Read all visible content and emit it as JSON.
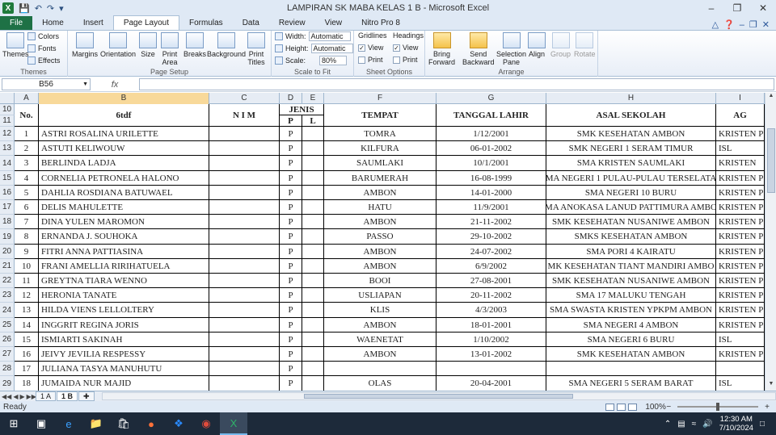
{
  "app": {
    "title": "LAMPIRAN SK MABA KELAS 1 B  -  Microsoft Excel"
  },
  "ribbon_tabs": [
    "File",
    "Home",
    "Insert",
    "Page Layout",
    "Formulas",
    "Data",
    "Review",
    "View",
    "Nitro Pro 8"
  ],
  "active_tab": "Page Layout",
  "ribbon": {
    "themes": {
      "themes": "Themes",
      "colors": "Colors",
      "fonts": "Fonts",
      "effects": "Effects",
      "label": "Themes"
    },
    "page_setup": {
      "margins": "Margins",
      "orientation": "Orientation",
      "size": "Size",
      "print_area_1": "Print",
      "print_area_2": "Area",
      "breaks": "Breaks",
      "background": "Background",
      "print_titles_1": "Print",
      "print_titles_2": "Titles",
      "label": "Page Setup"
    },
    "scale_to_fit": {
      "width_label": "Width:",
      "width_value": "Automatic",
      "height_label": "Height:",
      "height_value": "Automatic",
      "scale_label": "Scale:",
      "scale_value": "80%",
      "label": "Scale to Fit"
    },
    "sheet_options": {
      "gridlines": "Gridlines",
      "headings": "Headings",
      "view": "View",
      "print": "Print",
      "label": "Sheet Options"
    },
    "arrange": {
      "bring_forward_1": "Bring",
      "bring_forward_2": "Forward",
      "send_backward_1": "Send",
      "send_backward_2": "Backward",
      "selection_pane_1": "Selection",
      "selection_pane_2": "Pane",
      "align": "Align",
      "group": "Group",
      "rotate": "Rotate",
      "label": "Arrange"
    }
  },
  "formula_bar": {
    "name_box": "B56",
    "fx": "fx",
    "formula": ""
  },
  "columns": [
    "A",
    "B",
    "C",
    "D",
    "E",
    "F",
    "G",
    "H",
    "I"
  ],
  "selected_column": "B",
  "header_rows": [
    "10",
    "11"
  ],
  "headers": {
    "no": "No.",
    "name": "6tdf",
    "nim": "N I M",
    "jenis": "JENIS",
    "p": "P",
    "l": "L",
    "tempat": "TEMPAT",
    "tanggal": "TANGGAL LAHIR",
    "asal": "ASAL SEKOLAH",
    "agama": "AG"
  },
  "rows": [
    {
      "row": "12",
      "no": "1",
      "name": "ASTRI ROSALINA URILETTE",
      "nim": "",
      "p": "P",
      "l": "",
      "tempat": "TOMRA",
      "tanggal": "1/12/2001",
      "asal": "SMK KESEHATAN AMBON",
      "agama": "KRISTEN P"
    },
    {
      "row": "13",
      "no": "2",
      "name": "ASTUTI KELIWOUW",
      "nim": "",
      "p": "P",
      "l": "",
      "tempat": "KILFURA",
      "tanggal": "06-01-2002",
      "asal": "SMK NEGERI 1 SERAM TIMUR",
      "agama": "ISL"
    },
    {
      "row": "14",
      "no": "3",
      "name": "BERLINDA LADJA",
      "nim": "",
      "p": "P",
      "l": "",
      "tempat": "SAUMLAKI",
      "tanggal": "10/1/2001",
      "asal": "SMA KRISTEN SAUMLAKI",
      "agama": "KRISTEN"
    },
    {
      "row": "15",
      "no": "4",
      "name": "CORNELIA PETRONELA HALONO",
      "nim": "",
      "p": "P",
      "l": "",
      "tempat": "BARUMERAH",
      "tanggal": "16-08-1999",
      "asal": "MA NEGERI 1 PULAU-PULAU TERSELATA",
      "agama": "KRISTEN P"
    },
    {
      "row": "16",
      "no": "5",
      "name": "DAHLIA ROSDIANA BATUWAEL",
      "nim": "",
      "p": "P",
      "l": "",
      "tempat": "AMBON",
      "tanggal": "14-01-2000",
      "asal": "SMA NEGERI 10 BURU",
      "agama": "KRISTEN P"
    },
    {
      "row": "17",
      "no": "6",
      "name": "DELIS MAHULETTE",
      "nim": "",
      "p": "P",
      "l": "",
      "tempat": "HATU",
      "tanggal": "11/9/2001",
      "asal": "MA ANOKASA LANUD PATTIMURA AMBO",
      "agama": "KRISTEN P"
    },
    {
      "row": "18",
      "no": "7",
      "name": "DINA YULEN MAROMON",
      "nim": "",
      "p": "P",
      "l": "",
      "tempat": "AMBON",
      "tanggal": "21-11-2002",
      "asal": "SMK KESEHATAN NUSANIWE AMBON",
      "agama": "KRISTEN P"
    },
    {
      "row": "19",
      "no": "8",
      "name": "ERNANDA J. SOUHOKA",
      "nim": "",
      "p": "P",
      "l": "",
      "tempat": "PASSO",
      "tanggal": "29-10-2002",
      "asal": "SMKS KESEHATAN AMBON",
      "agama": "KRISTEN P"
    },
    {
      "row": "20",
      "no": "9",
      "name": "FITRI ANNA PATTIASINA",
      "nim": "",
      "p": "P",
      "l": "",
      "tempat": "AMBON",
      "tanggal": "24-07-2002",
      "asal": "SMA PORI 4 KAIRATU",
      "agama": "KRISTEN P"
    },
    {
      "row": "21",
      "no": "10",
      "name": "FRANI AMELLIA RIRIHATUELA",
      "nim": "",
      "p": "P",
      "l": "",
      "tempat": "AMBON",
      "tanggal": "6/9/2002",
      "asal": "MK  KESEHATAN TIANT MANDIRI AMBO",
      "agama": "KRISTEN P"
    },
    {
      "row": "22",
      "no": "11",
      "name": "GREYTNA TIARA WENNO",
      "nim": "",
      "p": "P",
      "l": "",
      "tempat": "BOOI",
      "tanggal": "27-08-2001",
      "asal": "SMK KESEHATAN NUSANIWE AMBON",
      "agama": "KRISTEN P"
    },
    {
      "row": "23",
      "no": "12",
      "name": "HERONIA TANATE",
      "nim": "",
      "p": "P",
      "l": "",
      "tempat": "USLIAPAN",
      "tanggal": "20-11-2002",
      "asal": "SMA 17 MALUKU TENGAH",
      "agama": "KRISTEN P"
    },
    {
      "row": "24",
      "no": "13",
      "name": "HILDA VIENS LELLOLTERY",
      "nim": "",
      "p": "P",
      "l": "",
      "tempat": "KLIS",
      "tanggal": "4/3/2003",
      "asal": "SMA SWASTA KRISTEN YPKPM AMBON",
      "agama": "KRISTEN P"
    },
    {
      "row": "25",
      "no": "14",
      "name": "INGGRIT REGINA JORIS",
      "nim": "",
      "p": "P",
      "l": "",
      "tempat": "AMBON",
      "tanggal": "18-01-2001",
      "asal": "SMA NEGERI 4 AMBON",
      "agama": "KRISTEN P"
    },
    {
      "row": "26",
      "no": "15",
      "name": "ISMIARTI SAKINAH",
      "nim": "",
      "p": "P",
      "l": "",
      "tempat": "WAENETAT",
      "tanggal": "1/10/2002",
      "asal": "SMA NEGERI 6 BURU",
      "agama": "ISL"
    },
    {
      "row": "27",
      "no": "16",
      "name": "JEIVY JEVILIA RESPESSY",
      "nim": "",
      "p": "P",
      "l": "",
      "tempat": "AMBON",
      "tanggal": "13-01-2002",
      "asal": "SMK KESEHATAN AMBON",
      "agama": "KRISTEN P"
    },
    {
      "row": "28",
      "no": "17",
      "name": "JULIANA TASYA MANUHUTU",
      "nim": "",
      "p": "P",
      "l": "",
      "tempat": "",
      "tanggal": "",
      "asal": "",
      "agama": ""
    },
    {
      "row": "29",
      "no": "18",
      "name": "JUMAIDA NUR MAJID",
      "nim": "",
      "p": "P",
      "l": "",
      "tempat": "OLAS",
      "tanggal": "20-04-2001",
      "asal": "SMA NEGERI 5 SERAM BARAT",
      "agama": "ISL"
    }
  ],
  "sheets": [
    "1 A",
    "1 B"
  ],
  "active_sheet": "1 B",
  "status": {
    "ready": "Ready",
    "zoom": "100%"
  },
  "taskbar": {
    "time": "12:30 AM",
    "date": "7/10/2024"
  }
}
